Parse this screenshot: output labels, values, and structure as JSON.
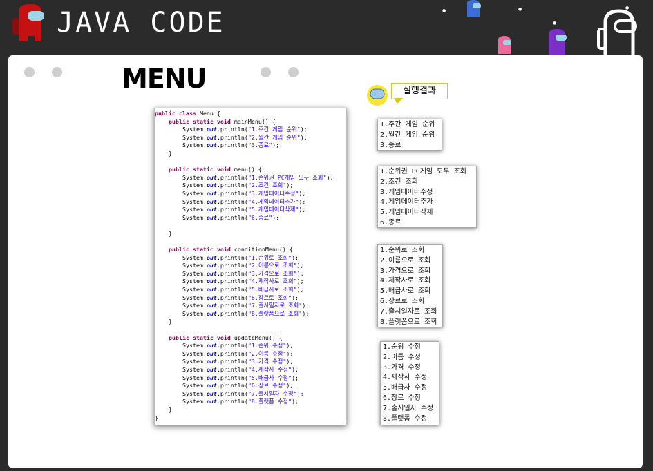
{
  "header": {
    "title": "JAVA CODE"
  },
  "main": {
    "heading": "MENU",
    "result_label": "실행결과",
    "code": [
      {
        "t": "class-open",
        "a": "public class ",
        "b": "Menu {"
      },
      {
        "t": "method",
        "name": "mainMenu() {"
      },
      {
        "t": "print",
        "s": "\"1.주간 게임 순위\""
      },
      {
        "t": "print",
        "s": "\"2.월간 게임 순위\""
      },
      {
        "t": "print",
        "s": "\"3.종료\""
      },
      {
        "t": "close"
      },
      {
        "t": "blank"
      },
      {
        "t": "method",
        "name": "menu() {"
      },
      {
        "t": "print",
        "s": "\"1.순위권 PC게임 모두 조회\""
      },
      {
        "t": "print",
        "s": "\"2.조건 조회\""
      },
      {
        "t": "print",
        "s": "\"3.게임데이터수정\""
      },
      {
        "t": "print",
        "s": "\"4.게임데이터추가\""
      },
      {
        "t": "print",
        "s": "\"5.게임데이터삭제\""
      },
      {
        "t": "print",
        "s": "\"6.종료\""
      },
      {
        "t": "blank"
      },
      {
        "t": "close"
      },
      {
        "t": "blank"
      },
      {
        "t": "method",
        "name": "conditionMenu() {"
      },
      {
        "t": "print",
        "s": "\"1.순위로 조회\""
      },
      {
        "t": "print",
        "s": "\"2.이름으로 조회\""
      },
      {
        "t": "print",
        "s": "\"3.가격으로 조회\""
      },
      {
        "t": "print",
        "s": "\"4.제작사로 조회\""
      },
      {
        "t": "print",
        "s": "\"5.배급사로 조회\""
      },
      {
        "t": "print",
        "s": "\"6.장르로 조회\""
      },
      {
        "t": "print",
        "s": "\"7.출시일자로 조회\""
      },
      {
        "t": "print",
        "s": "\"8.플랫폼으로 조회\""
      },
      {
        "t": "close"
      },
      {
        "t": "blank"
      },
      {
        "t": "method",
        "name": "updateMenu() {"
      },
      {
        "t": "print",
        "s": "\"1.순위 수정\""
      },
      {
        "t": "print",
        "s": "\"2.이름 수정\""
      },
      {
        "t": "print",
        "s": "\"3.가격 수정\""
      },
      {
        "t": "print",
        "s": "\"4.제작사 수정\""
      },
      {
        "t": "print",
        "s": "\"5.배급사 수정\""
      },
      {
        "t": "print",
        "s": "\"6.장르 수정\""
      },
      {
        "t": "print",
        "s": "\"7.출시일자 수정\""
      },
      {
        "t": "print",
        "s": "\"8.플랫폼 수정\""
      },
      {
        "t": "close"
      },
      {
        "t": "class-close"
      }
    ],
    "code_tokens": {
      "public_static_void": "public static void ",
      "system": "System.",
      "out": "out",
      "println": ".println(",
      "end": ");",
      "close": "}"
    },
    "outputs": [
      [
        "1.주간 게임 순위",
        "2.월간 게임 순위",
        "3.종료"
      ],
      [
        "1.순위권 PC게임 모두 조회",
        "2.조건 조회",
        "3.게임데이터수정",
        "4.게임데이터추가",
        "5.게임데이터삭제",
        "6.종료"
      ],
      [
        "1.순위로 조회",
        "2.이름으로 조회",
        "3.가격으로 조회",
        "4.제작사로 조회",
        "5.배급사로 조회",
        "6.장르로 조회",
        "7.출시일자로 조회",
        "8.플랫폼으로 조회"
      ],
      [
        "1.순위 수정",
        "2.이름 수정",
        "3.가격 수정",
        "4.제작사 수정",
        "5.배급사 수정",
        "6.장르 수정",
        "7.출시일자 수정",
        "8.플랫폼 수정"
      ]
    ]
  },
  "colors": {
    "keyword": "#7a0055",
    "out": "#0000c0",
    "string": "#2a00ff",
    "crewmate_red": "#c51111"
  },
  "icons": [
    "crewmate-red-icon",
    "crewmate-yellow-icon",
    "crewmate-purple-icon",
    "crewmate-white-icon"
  ]
}
